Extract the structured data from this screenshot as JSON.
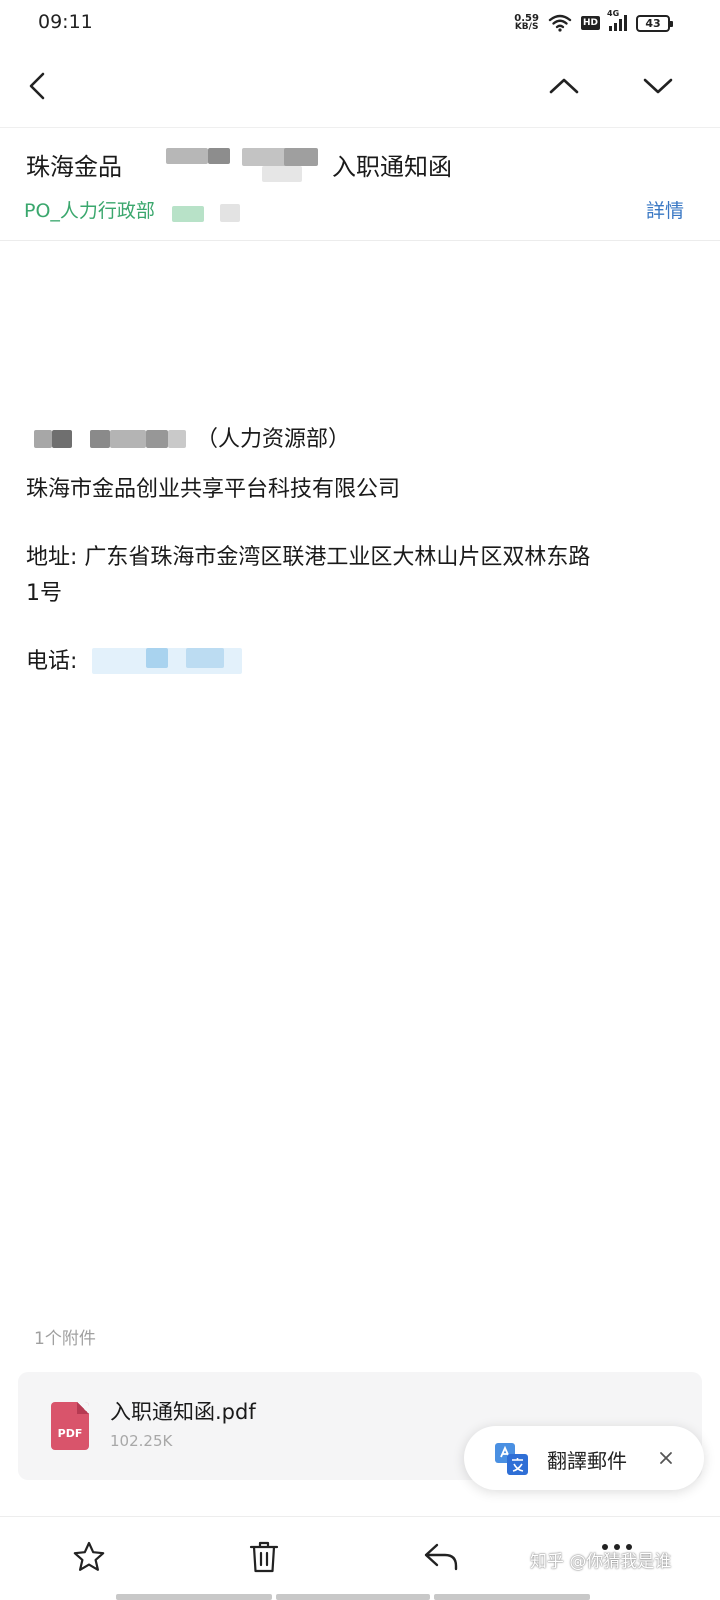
{
  "status_bar": {
    "time": "09:11",
    "net_speed_value": "0.59",
    "net_speed_unit": "KB/S",
    "hd_label": "HD",
    "network_label": "4G",
    "battery": "43"
  },
  "nav": {
    "back_icon": "chevron-left-icon",
    "prev_icon": "chevron-up-icon",
    "next_icon": "chevron-down-icon"
  },
  "email": {
    "subject_start": "珠海金品",
    "subject_end": "入职通知函",
    "sender": "PO_人力行政部",
    "details_label": "詳情",
    "body": {
      "dept": "（人力资源部）",
      "company": "珠海市金品创业共享平台科技有限公司",
      "address_line1": "地址: 广东省珠海市金湾区联港工业区大林山片区双林东路",
      "address_line2": "1号",
      "phone_label": "电话:"
    }
  },
  "attachments": {
    "count_label": "1个附件",
    "items": [
      {
        "name": "入职通知函.pdf",
        "size": "102.25K",
        "type_label": "PDF"
      }
    ]
  },
  "translate": {
    "label": "翻譯郵件",
    "icon": "translate-icon"
  },
  "toolbar": {
    "items": [
      "star-icon",
      "trash-icon",
      "reply-icon",
      "more-icon"
    ]
  },
  "watermark": "知乎 @你猜我是谁",
  "colors": {
    "sender_green": "#3aa76d",
    "link_blue": "#3a78c4",
    "pdf_red": "#d9546b"
  }
}
